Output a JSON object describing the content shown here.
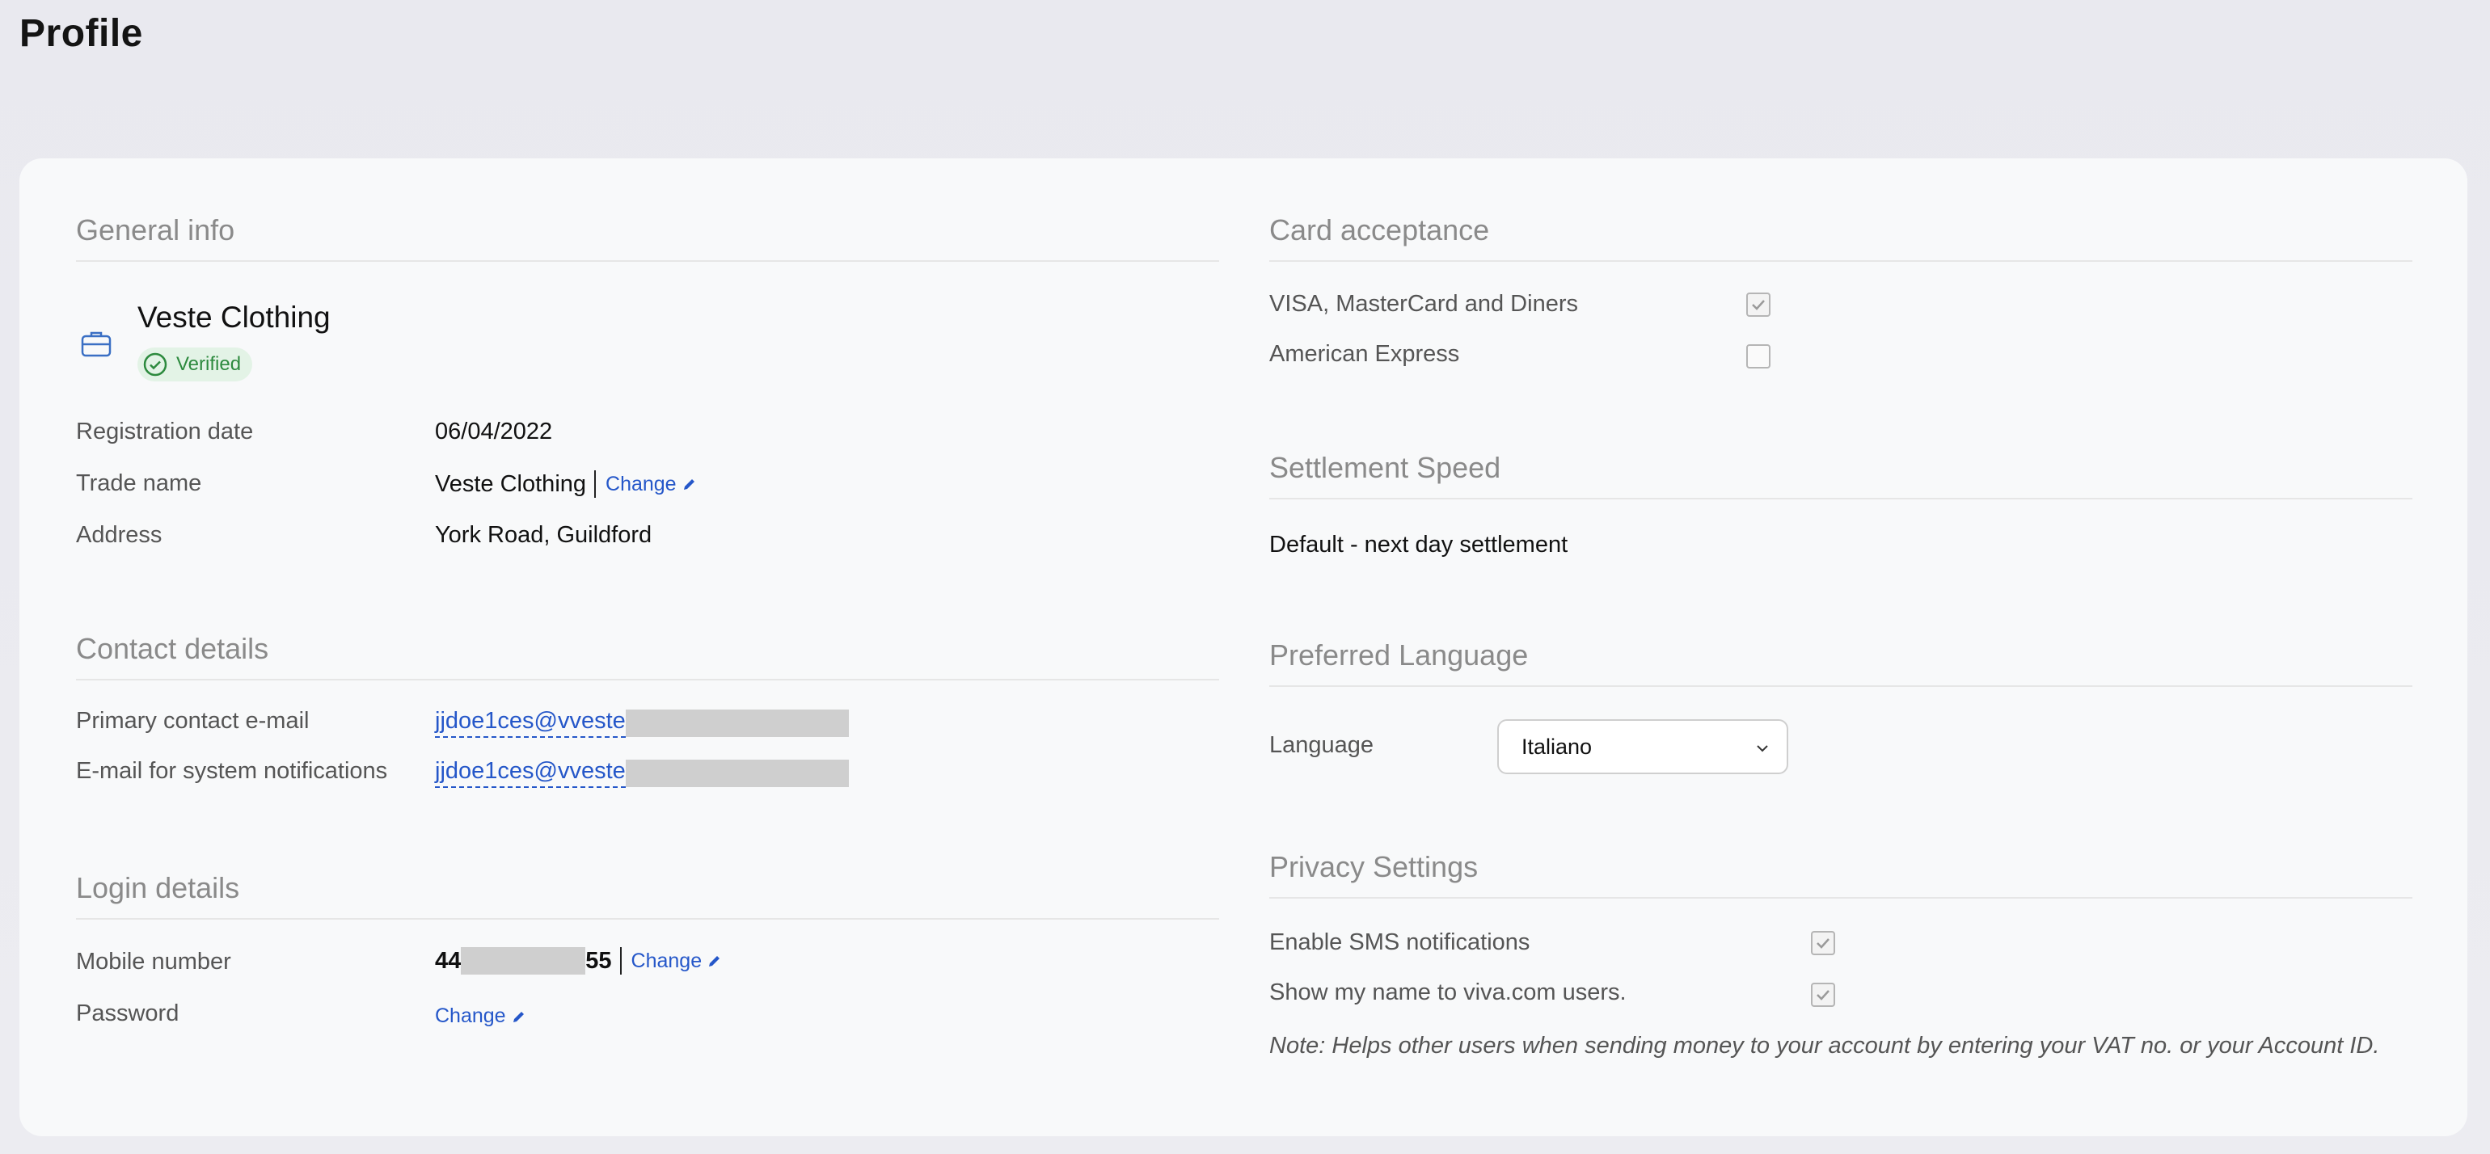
{
  "page": {
    "title": "Profile"
  },
  "general_info": {
    "title": "General info",
    "company_name": "Veste Clothing",
    "badge": "Verified",
    "rows": {
      "registration_label": "Registration date",
      "registration_value": "06/04/2022",
      "trade_label": "Trade name",
      "trade_value": "Veste Clothing",
      "trade_change": "Change",
      "address_label": "Address",
      "address_value": "York Road, Guildford"
    }
  },
  "contact_details": {
    "title": "Contact details",
    "primary_label": "Primary contact e-mail",
    "primary_value": "jjdoe1ces@vveste",
    "system_label": "E-mail for system notifications",
    "system_value": "jjdoe1ces@vveste"
  },
  "login_details": {
    "title": "Login details",
    "mobile_label": "Mobile number",
    "mobile_prefix": "44",
    "mobile_suffix": "55",
    "mobile_change": "Change",
    "password_label": "Password",
    "password_change": "Change"
  },
  "card_acceptance": {
    "title": "Card acceptance",
    "visa_label": "VISA, MasterCard and Diners",
    "visa_checked": true,
    "amex_label": "American Express",
    "amex_checked": false
  },
  "settlement": {
    "title": "Settlement Speed",
    "value": "Default - next day settlement"
  },
  "language": {
    "title": "Preferred Language",
    "label": "Language",
    "selected": "Italiano"
  },
  "privacy": {
    "title": "Privacy Settings",
    "sms_label": "Enable SMS notifications",
    "sms_checked": true,
    "show_name_label": "Show my name to viva.com users.",
    "show_name_checked": true,
    "note": "Note: Helps other users when sending money to your account by entering your VAT no. or your Account ID."
  },
  "colors": {
    "link": "#2557c9",
    "verified": "#2d8a3e",
    "section_title": "#8a8a8a"
  }
}
